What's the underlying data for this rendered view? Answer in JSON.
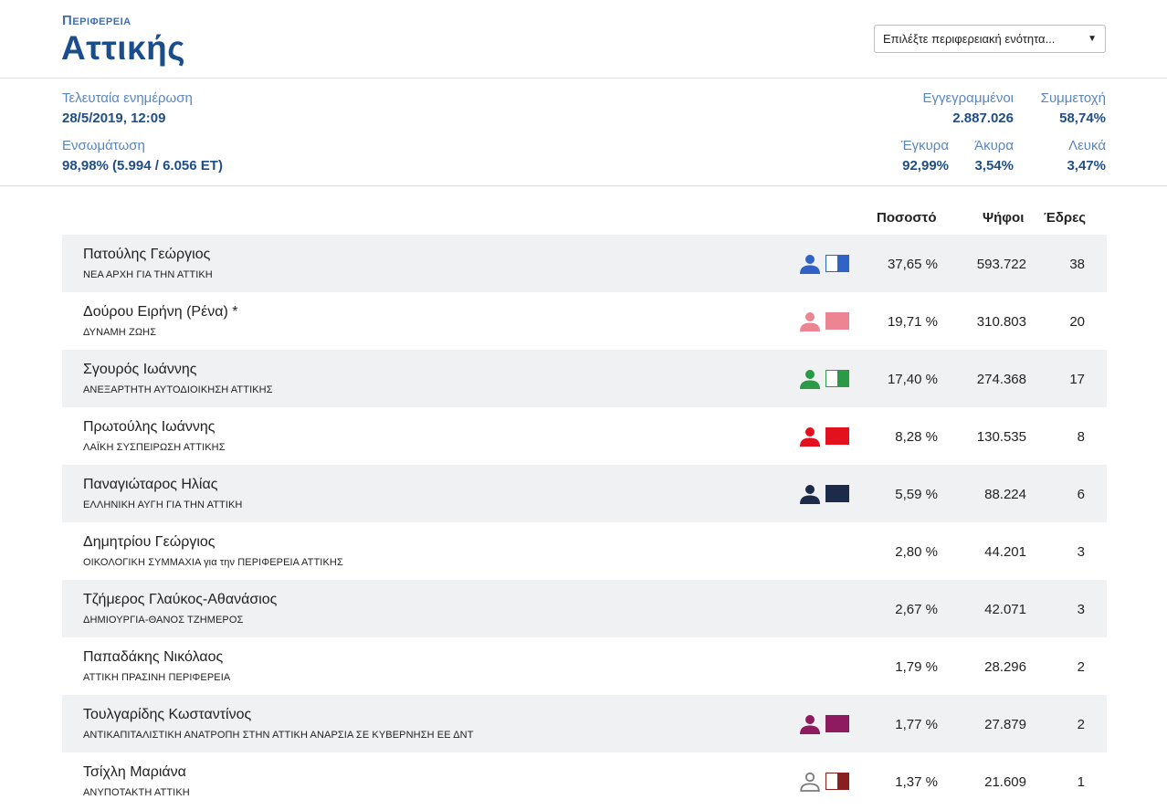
{
  "header": {
    "region_label": "Περιφερεια",
    "region_name": "Αττικής",
    "select_placeholder": "Επιλέξτε περιφερειακή ενότητα..."
  },
  "stats": {
    "last_update_label": "Τελευταία ενημέρωση",
    "last_update_value": "28/5/2019, 12:09",
    "integration_label": "Ενσωμάτωση",
    "integration_value": "98,98% (5.994 / 6.056 ΕΤ)",
    "registered_label": "Εγγεγραμμένοι",
    "registered_value": "2.887.026",
    "turnout_label": "Συμμετοχή",
    "turnout_value": "58,74%",
    "valid_label": "Έγκυρα",
    "valid_value": "92,99%",
    "invalid_label": "Άκυρα",
    "invalid_value": "3,54%",
    "blank_label": "Λευκά",
    "blank_value": "3,47%"
  },
  "table": {
    "col_percent": "Ποσοστό",
    "col_votes": "Ψήφοι",
    "col_seats": "Έδρες",
    "rows": [
      {
        "name": "Πατούλης Γεώργιος",
        "party": "ΝΕΑ ΑΡΧΗ ΓΙΑ ΤΗΝ ΑΤΤΙΚΗ",
        "percent": "37,65 %",
        "votes": "593.722",
        "seats": "38",
        "color": "#2f63c5",
        "flag": "split",
        "icon": "person-icon"
      },
      {
        "name": "Δούρου Ειρήνη (Ρένα) *",
        "party": "ΔΥΝΑΜΗ ΖΩΗΣ",
        "percent": "19,71 %",
        "votes": "310.803",
        "seats": "20",
        "color": "#ec8592",
        "flag": "solid",
        "icon": "person-icon"
      },
      {
        "name": "Σγουρός Ιωάννης",
        "party": "ΑΝΕΞΑΡΤΗΤΗ ΑΥΤΟΔΙΟΙΚΗΣΗ ΑΤΤΙΚΗΣ",
        "percent": "17,40 %",
        "votes": "274.368",
        "seats": "17",
        "color": "#2a9a46",
        "flag": "split",
        "icon": "person-icon"
      },
      {
        "name": "Πρωτούλης Ιωάννης",
        "party": "ΛΑΪΚΗ ΣΥΣΠΕΙΡΩΣΗ ΑΤΤΙΚΗΣ",
        "percent": "8,28 %",
        "votes": "130.535",
        "seats": "8",
        "color": "#e3101e",
        "flag": "solid",
        "icon": "person-icon"
      },
      {
        "name": "Παναγιώταρος Ηλίας",
        "party": "ΕΛΛΗΝΙΚΗ ΑΥΓΗ ΓΙΑ ΤΗΝ ΑΤΤΙΚΗ",
        "percent": "5,59 %",
        "votes": "88.224",
        "seats": "6",
        "color": "#1c2b4a",
        "flag": "solid",
        "icon": "person-icon"
      },
      {
        "name": "Δημητρίου Γεώργιος",
        "party": "ΟΙΚΟΛΟΓΙΚΗ ΣΥΜΜΑΧΙΑ για την ΠΕΡΙΦΕΡΕΙΑ ΑΤΤΙΚΗΣ",
        "percent": "2,80 %",
        "votes": "44.201",
        "seats": "3",
        "color": "",
        "flag": "none",
        "icon": ""
      },
      {
        "name": "Τζήμερος Γλαύκος-Αθανάσιος",
        "party": "ΔΗΜΙΟΥΡΓΙΑ-ΘΑΝΟΣ ΤΖΗΜΕΡΟΣ",
        "percent": "2,67 %",
        "votes": "42.071",
        "seats": "3",
        "color": "",
        "flag": "none",
        "icon": ""
      },
      {
        "name": "Παπαδάκης Νικόλαος",
        "party": "ΑΤΤΙΚΗ ΠΡΑΣΙΝΗ ΠΕΡΙΦΕΡΕΙΑ",
        "percent": "1,79 %",
        "votes": "28.296",
        "seats": "2",
        "color": "",
        "flag": "none",
        "icon": ""
      },
      {
        "name": "Τουλγαρίδης Κωσταντίνος",
        "party": "ΑΝΤΙΚΑΠΙΤΑΛΙΣΤΙΚΗ ΑΝΑΤΡΟΠΗ ΣΤΗΝ ΑΤΤΙΚΗ ΑΝΑΡΣΙΑ ΣΕ ΚΥΒΕΡΝΗΣΗ ΕΕ ΔΝΤ",
        "percent": "1,77 %",
        "votes": "27.879",
        "seats": "2",
        "color": "#8e1a5f",
        "flag": "solid",
        "icon": "person-icon"
      },
      {
        "name": "Τσίχλη Μαριάνα",
        "party": "ΑΝΥΠΟΤΑΚΤΗ ΑΤΤΙΚΗ",
        "percent": "1,37 %",
        "votes": "21.609",
        "seats": "1",
        "color": "#8a1f1f",
        "flag": "split",
        "icon": "person-outline-icon",
        "icon_color": "#7a7a7a"
      }
    ]
  }
}
